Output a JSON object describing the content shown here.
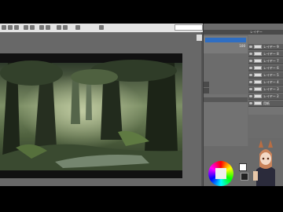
{
  "app": {
    "title": ""
  },
  "toolbar": {
    "search_placeholder": ""
  },
  "navigator": {
    "zoom_label": "100"
  },
  "panels": {
    "layer_title": "レイヤー",
    "sub_title": ""
  },
  "layers": [
    {
      "name": "レイヤー 9"
    },
    {
      "name": "レイヤー 8"
    },
    {
      "name": "レイヤー 7"
    },
    {
      "name": "レイヤー 6"
    },
    {
      "name": "レイヤー 5"
    },
    {
      "name": "レイヤー 4"
    },
    {
      "name": "レイヤー 3"
    },
    {
      "name": "レイヤー 2"
    },
    {
      "name": "用紙"
    }
  ],
  "colors": {
    "main": "#ffffff",
    "sub": "#222222",
    "accent": "#2f6ec2"
  },
  "canvas": {
    "subject": "forest painting"
  }
}
